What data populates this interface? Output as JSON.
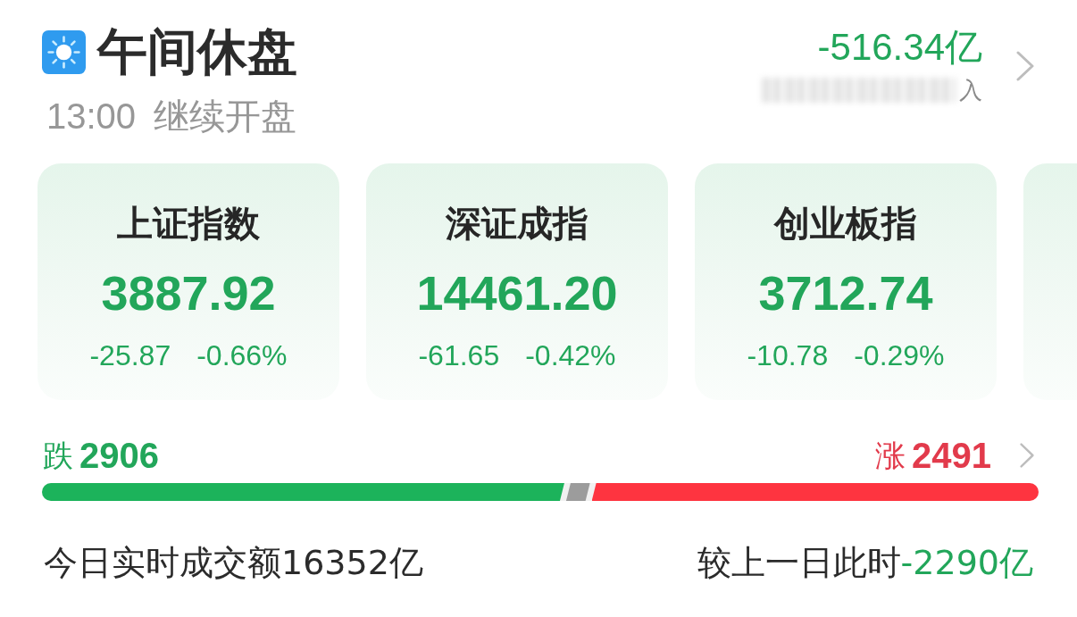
{
  "header": {
    "title": "午间休盘",
    "time": "13:00",
    "status": "继续开盘"
  },
  "net_flow": {
    "value": "-516.34亿",
    "caption_tail": "入"
  },
  "indices": [
    {
      "name": "上证指数",
      "value": "3887.92",
      "change": "-25.87",
      "change_pct": "-0.66%"
    },
    {
      "name": "深证成指",
      "value": "14461.20",
      "change": "-61.65",
      "change_pct": "-0.42%"
    },
    {
      "name": "创业板指",
      "value": "3712.74",
      "change": "-10.78",
      "change_pct": "-0.29%"
    }
  ],
  "breadth": {
    "down_label": "跌",
    "down_count": "2906",
    "up_label": "涨",
    "up_count": "2491",
    "segments": [
      {
        "kind": "down",
        "level": 0.526
      },
      {
        "kind": "flat"
      },
      {
        "kind": "up",
        "level": 0.45
      }
    ]
  },
  "turnover": {
    "text": "今日实时成交额16352亿",
    "compare_label": "较上一日此时",
    "compare_value": "-2290亿"
  }
}
